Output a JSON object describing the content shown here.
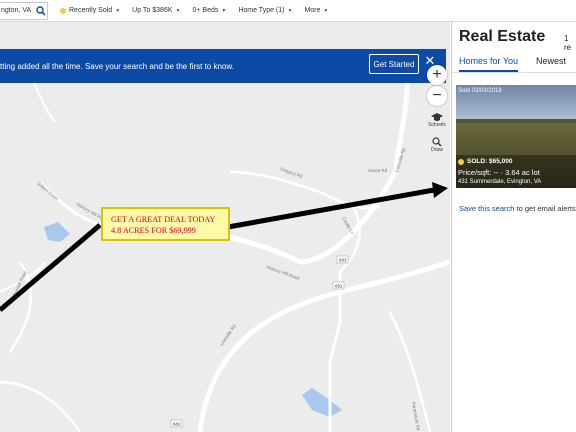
{
  "search": {
    "value": "ngton, VA"
  },
  "filters": [
    {
      "label": "Recently Sold",
      "status_color": "#f7c948"
    },
    {
      "label": "Up To $386K"
    },
    {
      "label": "0+ Beds"
    },
    {
      "label": "Home Type (1)"
    },
    {
      "label": "More"
    }
  ],
  "banner": {
    "text": "tting added all the time. Save your search and be the first to know.",
    "cta": "Get Started",
    "close": "✕"
  },
  "map": {
    "roads": [
      "Gilbert Court",
      "Hickory Hill Rd",
      "Hickory Hill Road",
      "Hickory Hill Road",
      "Leesville Rd",
      "Leesville Rd",
      "Castle Ln",
      "Gregory Rd",
      "Grace Rd",
      "Paramount Rd",
      "Gunnell Road"
    ],
    "route_shields": [
      "683",
      "691",
      "682"
    ],
    "tools": {
      "zoom_in": "+",
      "zoom_out": "−",
      "schools": "Schools",
      "draw": "Draw"
    }
  },
  "callout": {
    "line1": "GET A GREAT DEAL TODAY",
    "line2": "4.8 ACRES FOR $69,999"
  },
  "panel": {
    "title": "Real Estate",
    "count": "1 re",
    "tabs": [
      "Homes for You",
      "Newest"
    ],
    "listing": {
      "sold_date": "Sold 03/03/2018",
      "sold_label": "SOLD: $65,000",
      "price_line": "Price/sqft: -- · 3.64 ac lot",
      "address": "431 Summerdale, Evington, VA"
    },
    "save_link": "Save this search",
    "save_rest": " to get email alerts"
  },
  "colors": {
    "brand": "#0d4aa6",
    "callout_bg": "#fff9a8",
    "callout_text": "#e0001a",
    "sold_dot": "#f7c948"
  }
}
